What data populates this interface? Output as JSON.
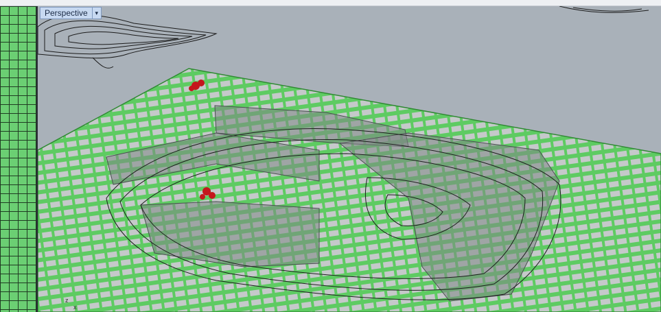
{
  "viewport": {
    "title": "Perspective",
    "dropdown_glyph": "▾",
    "axis_labels": {
      "z": "z",
      "x": "x"
    }
  },
  "colors": {
    "background": "#a9b1b9",
    "terrain_green": "#5ecb62",
    "terrain_gray": "#c5c9ca",
    "volume_gray": "#7f8687",
    "marker_red": "#c4161c"
  },
  "icons": [
    "chevron-down-icon",
    "axis-gizmo-icon",
    "point-marker-icon"
  ]
}
